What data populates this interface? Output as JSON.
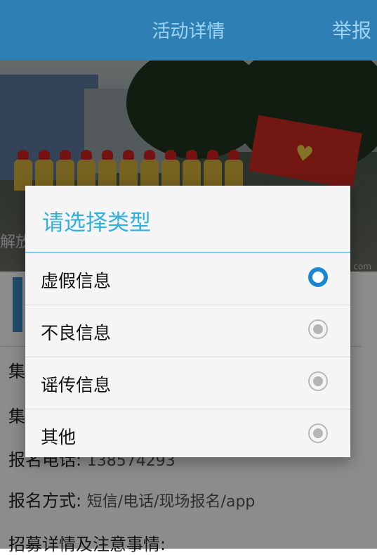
{
  "header": {
    "title": "活动详情",
    "report_label": "举报"
  },
  "hero": {
    "overlay_text": "解放",
    "corner_text": "com"
  },
  "detail": {
    "lines": [
      {
        "label": "集",
        "value": ""
      },
      {
        "label": "集",
        "value": ""
      },
      {
        "label": "报名电话:",
        "value": "138574293"
      },
      {
        "label": "报名方式:",
        "value": "短信/电话/现场报名/app"
      },
      {
        "label": "招募详情及注意事情:",
        "value": ""
      }
    ]
  },
  "dialog": {
    "title": "请选择类型",
    "options": [
      {
        "label": "虚假信息",
        "selected": true
      },
      {
        "label": "不良信息",
        "selected": false
      },
      {
        "label": "谣传信息",
        "selected": false
      },
      {
        "label": "其他",
        "selected": false
      }
    ]
  },
  "colors": {
    "header_bg": "#2e7fb3",
    "header_text": "#9ed4f2",
    "dialog_title": "#32b0dc",
    "radio_selected": "#1a87d0"
  }
}
